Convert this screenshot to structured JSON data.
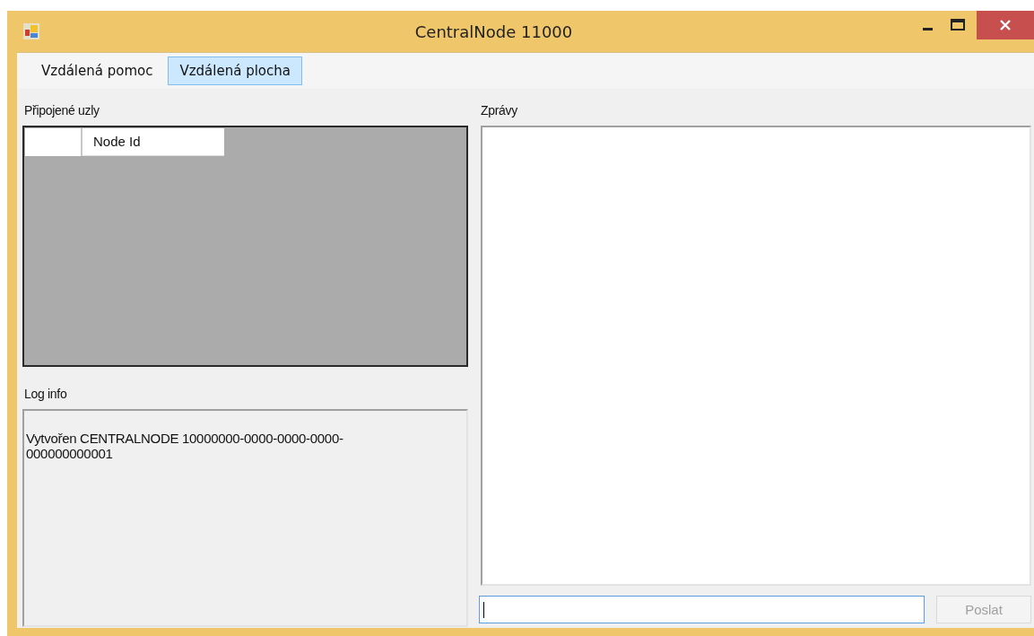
{
  "window": {
    "title": "CentralNode 11000"
  },
  "tabs": [
    {
      "label": "Vzdálená pomoc",
      "selected": false
    },
    {
      "label": "Vzdálená plocha",
      "selected": true
    }
  ],
  "connected_nodes": {
    "label": "Připojené uzly",
    "columns": [
      "Node Id"
    ]
  },
  "log": {
    "label": "Log info",
    "text": "Vytvořen CENTRALNODE 10000000-0000-0000-0000-000000000001"
  },
  "messages": {
    "label": "Zprávy"
  },
  "message_input": {
    "focused": true
  },
  "send_button": {
    "label": "Poslat",
    "disabled": true
  }
}
